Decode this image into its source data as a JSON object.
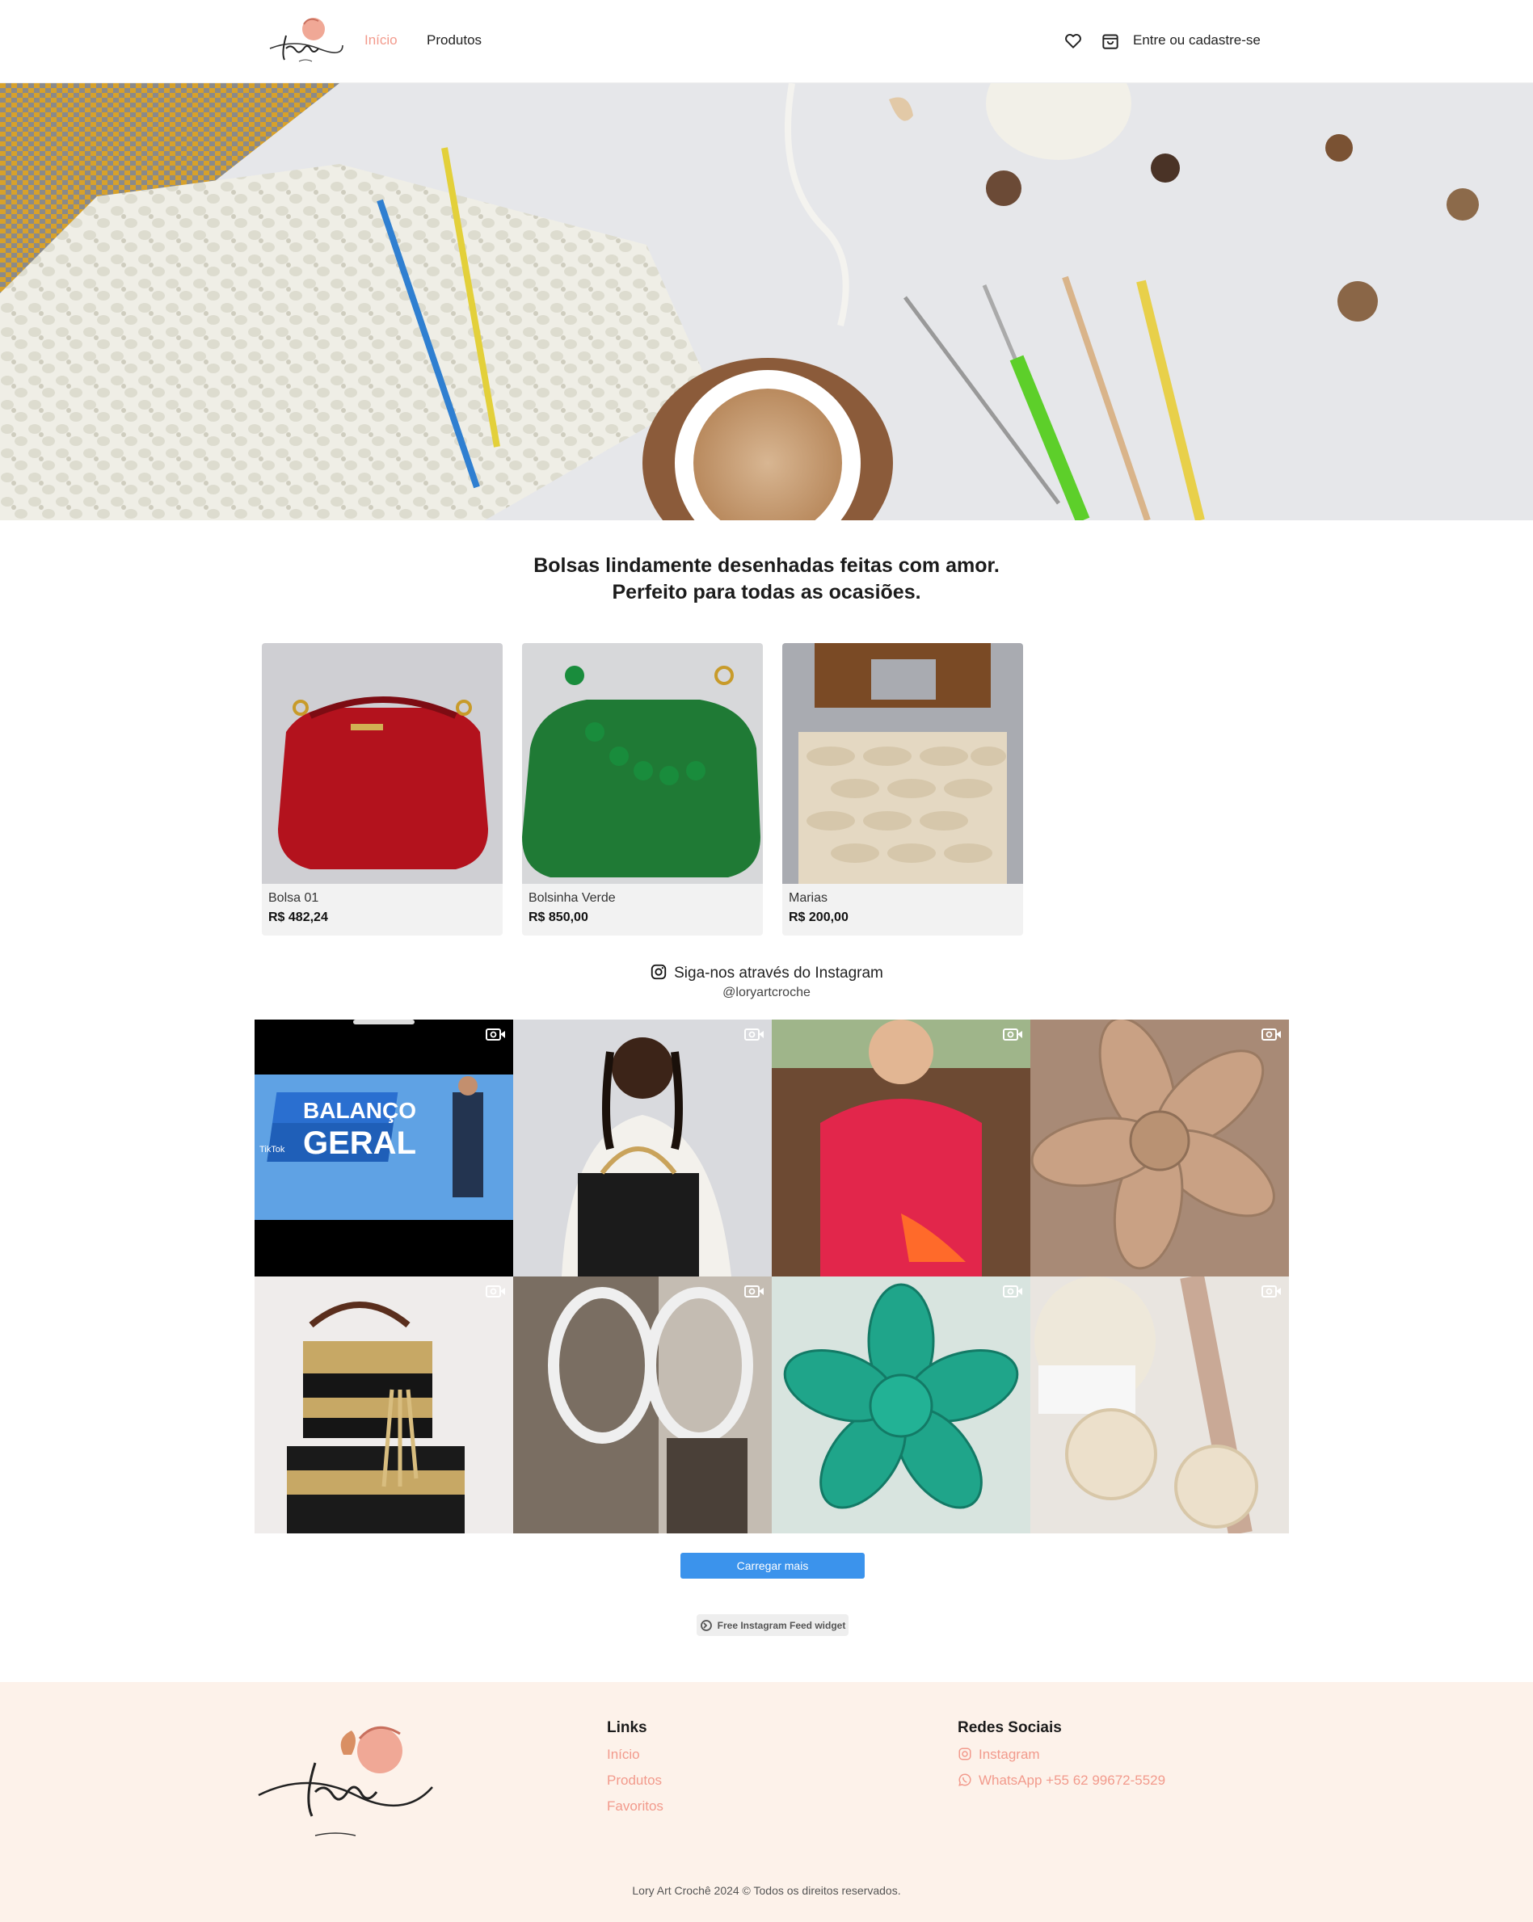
{
  "header": {
    "nav": [
      {
        "label": "Início",
        "active": true
      },
      {
        "label": "Produtos",
        "active": false
      }
    ],
    "favorites_icon": "heart-icon",
    "cart_icon": "shopping-bag-icon",
    "login_label": "Entre ou cadastre-se"
  },
  "tagline": {
    "line1": "Bolsas lindamente desenhadas feitas com amor.",
    "line2": "Perfeito para todas as ocasiões."
  },
  "products": [
    {
      "name": "Bolsa 01",
      "price": "R$ 482,24",
      "color": "#b3121d"
    },
    {
      "name": "Bolsinha Verde",
      "price": "R$ 850,00",
      "color": "#1f7a35"
    },
    {
      "name": "Marias",
      "price": "R$ 200,00",
      "color": "#e4d8c2"
    }
  ],
  "instagram": {
    "title": "Siga-nos através do Instagram",
    "handle": "@loryartcroche",
    "load_more": "Carregar mais",
    "widget_badge": "Free Instagram Feed widget",
    "video_tile_text": {
      "headline1": "BALANÇO",
      "headline2": "GERAL",
      "overlay": "TikTok"
    }
  },
  "footer": {
    "links_title": "Links",
    "links": [
      "Início",
      "Produtos",
      "Favoritos"
    ],
    "social_title": "Redes Sociais",
    "social": [
      {
        "label": "Instagram",
        "icon": "instagram-icon"
      },
      {
        "label": "WhatsApp +55 62 99672-5529",
        "icon": "whatsapp-icon"
      }
    ],
    "copyright": "Lory Art Crochê 2024 © Todos os direitos reservados."
  },
  "colors": {
    "accent": "#f29a8c",
    "button": "#3b93ec",
    "footer_bg": "#fdf2ea"
  }
}
